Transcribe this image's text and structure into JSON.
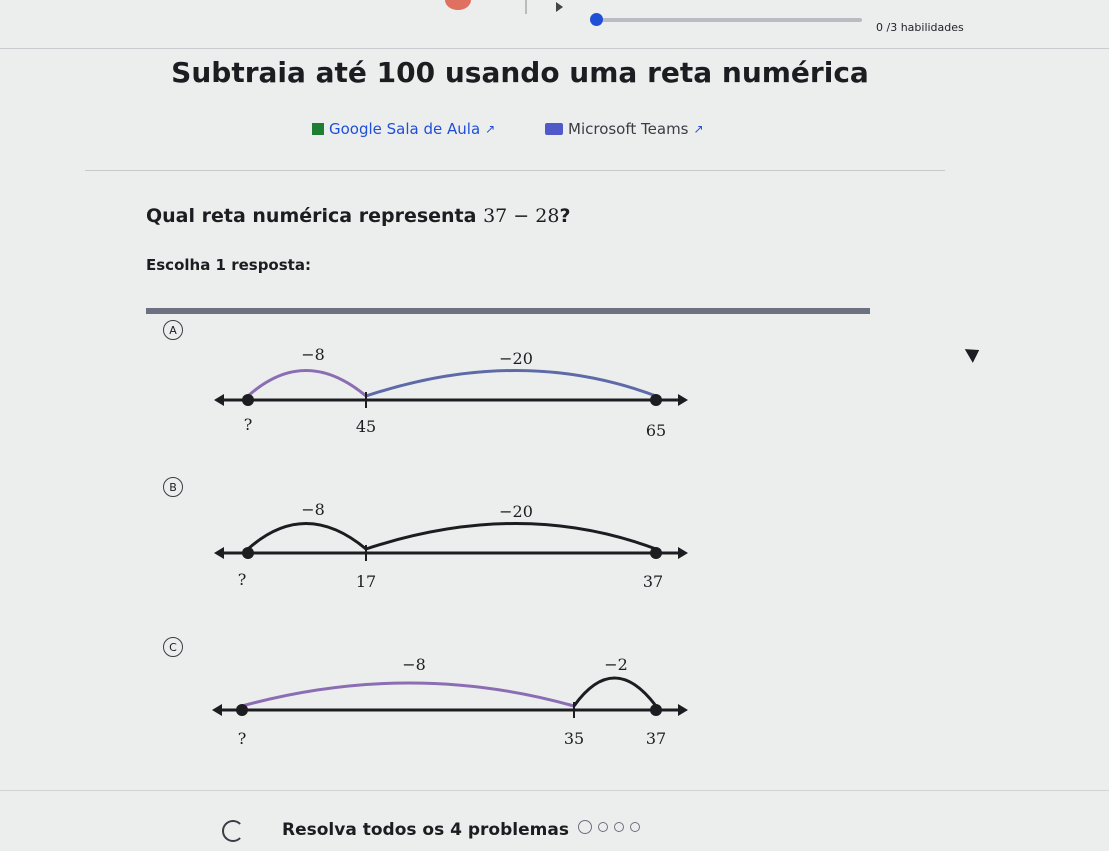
{
  "header": {
    "skills_text": "0 /3 habilidades",
    "progress_fraction": 0.0
  },
  "title": "Subtraia até 100 usando uma reta numérica",
  "share": {
    "google_classroom": "Google Sala de Aula",
    "microsoft_teams": "Microsoft Teams",
    "external_icon": "↗"
  },
  "question": {
    "prefix": "Qual reta numérica representa ",
    "math": "37 − 28",
    "suffix": "?"
  },
  "instruction": "Escolha 1 resposta:",
  "choices": [
    {
      "letter": "A",
      "jumps": [
        {
          "label": "−8"
        },
        {
          "label": "−20"
        }
      ],
      "points": [
        "?",
        "45",
        "65"
      ]
    },
    {
      "letter": "B",
      "jumps": [
        {
          "label": "−8"
        },
        {
          "label": "−20"
        }
      ],
      "points": [
        "?",
        "17",
        "37"
      ]
    },
    {
      "letter": "C",
      "jumps": [
        {
          "label": "−8"
        },
        {
          "label": "−2"
        }
      ],
      "points": [
        "?",
        "35",
        "37"
      ]
    }
  ],
  "footer": {
    "text": "Resolva todos os 4 problemas",
    "problem_count": 4
  },
  "colors": {
    "arc": "#8b6db3",
    "line": "#1b1d21",
    "accent": "#1f4fd6"
  }
}
